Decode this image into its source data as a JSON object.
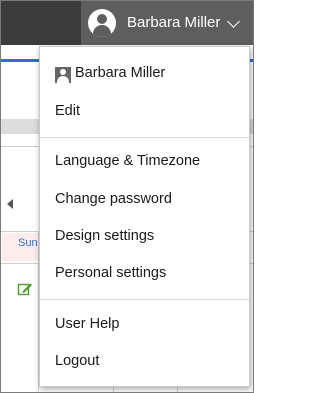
{
  "header": {
    "user_name": "Barbara Miller"
  },
  "background": {
    "sunday_label": "Sun"
  },
  "menu": {
    "profile_name": "Barbara Miller",
    "edit": "Edit",
    "language_timezone": "Language & Timezone",
    "change_password": "Change password",
    "design_settings": "Design settings",
    "personal_settings": "Personal settings",
    "user_help": "User Help",
    "logout": "Logout"
  },
  "colors": {
    "topbar": "#3b3b3b",
    "user_trigger": "#5e5e5e",
    "accent_blue": "#2f6fd0",
    "edit_icon_green": "#4a9a2c"
  },
  "icons": {
    "header_avatar": "user-avatar-icon",
    "menu_avatar": "user-icon",
    "dropdown_indicator": "chevron-down-icon",
    "nav_prev": "arrow-left-icon",
    "row_edit": "edit-icon"
  }
}
